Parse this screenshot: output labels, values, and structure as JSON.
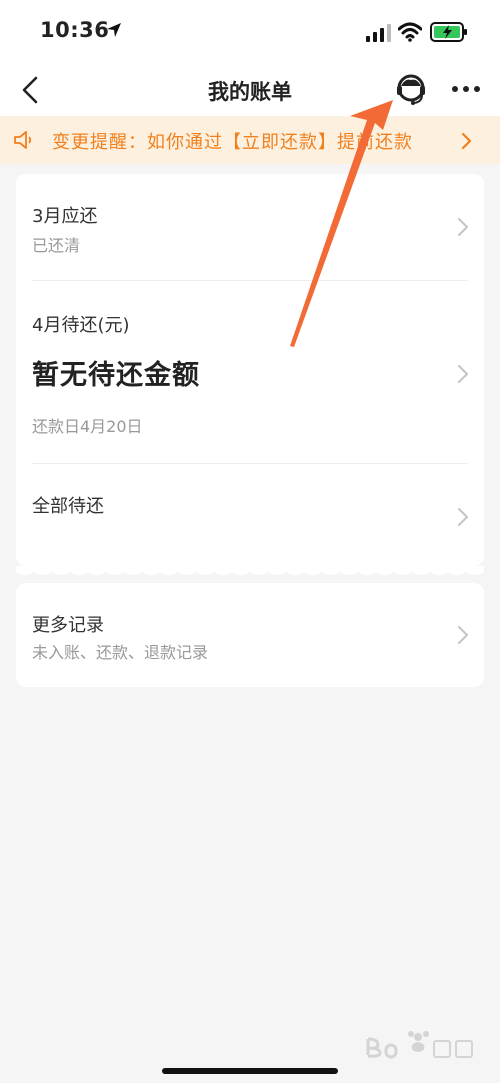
{
  "status_bar": {
    "time": "10:36"
  },
  "nav": {
    "title": "我的账单",
    "back_icon": "chevron-left-icon",
    "service_icon": "customer-service-icon",
    "more_icon": "more-icon"
  },
  "notice": {
    "text": "变更提醒：如你通过【立即还款】提前还款",
    "icon": "speaker-icon",
    "accent": "#f0801e",
    "background": "#fef0de"
  },
  "bill_card": {
    "march": {
      "title": "3月应还",
      "status": "已还清"
    },
    "april": {
      "title": "4月待还(元)",
      "amount_text": "暂无待还金额",
      "due_date": "还款日4月20日"
    },
    "all": {
      "title": "全部待还"
    }
  },
  "more_card": {
    "title": "更多记录",
    "subtitle": "未入账、还款、退款记录"
  },
  "annotation": {
    "color": "#f26a35"
  }
}
